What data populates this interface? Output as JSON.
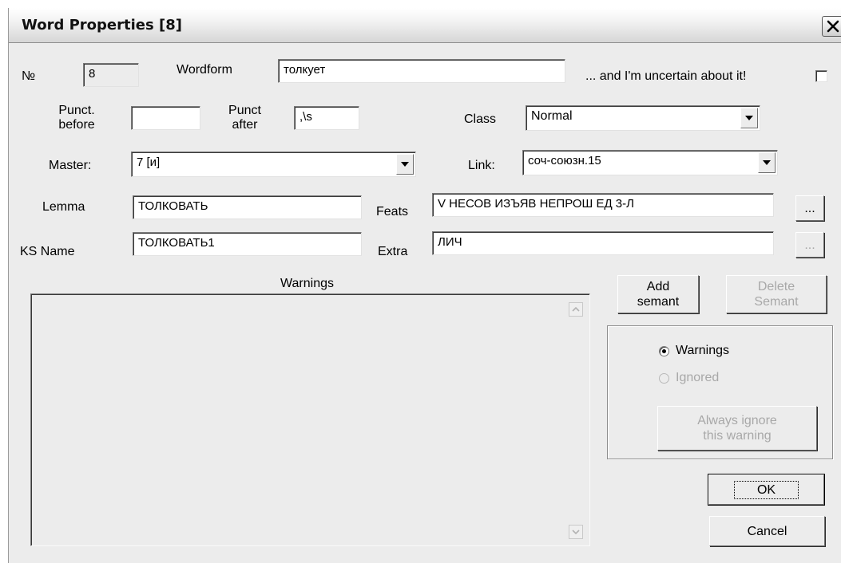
{
  "window": {
    "title": "Word Properties [8]",
    "close_glyph": "✕"
  },
  "fields": {
    "number": {
      "label": "№",
      "value": "8"
    },
    "wordform": {
      "label": "Wordform",
      "value": "толкует"
    },
    "uncertain": {
      "label": "... and I'm uncertain about it!",
      "checked": false
    },
    "punct_before": {
      "label_line1": "Punct.",
      "label_line2": "before",
      "value": ""
    },
    "punct_after": {
      "label_line1": "Punct",
      "label_line2": "after",
      "value": ",\\s"
    },
    "class": {
      "label": "Class",
      "value": "Normal"
    },
    "master": {
      "label": "Master:",
      "value": "7 [и]"
    },
    "link": {
      "label": "Link:",
      "value": "соч-союзн.15"
    },
    "lemma": {
      "label": "Lemma",
      "value": "ТОЛКОВАТЬ"
    },
    "feats": {
      "label": "Feats",
      "value": "V НЕСОВ ИЗЪЯВ НЕПРОШ ЕД 3-Л",
      "button": "..."
    },
    "ks_name": {
      "label": "KS Name",
      "value": "ТОЛКОВАТЬ1"
    },
    "extra": {
      "label": "Extra",
      "value": "ЛИЧ",
      "button": "..."
    }
  },
  "warnings": {
    "label": "Warnings",
    "text": ""
  },
  "buttons": {
    "add_semant_line1": "Add",
    "add_semant_line2": "semant",
    "delete_semant_line1": "Delete",
    "delete_semant_line2": "Semant",
    "always_ignore_line1": "Always ignore",
    "always_ignore_line2": "this warning",
    "ok": "OK",
    "cancel": "Cancel"
  },
  "radio": {
    "warnings": {
      "label": "Warnings",
      "selected": true
    },
    "ignored": {
      "label": "Ignored",
      "selected": false
    }
  },
  "colors": {
    "dialog_bg": "#ececec",
    "disabled_text": "#a8a8a8"
  },
  "icons": {
    "combo_arrow": "chevron-down-icon",
    "close": "close-icon",
    "scroll_up": "scroll-up-arrow-icon",
    "scroll_down": "scroll-down-arrow-icon"
  }
}
